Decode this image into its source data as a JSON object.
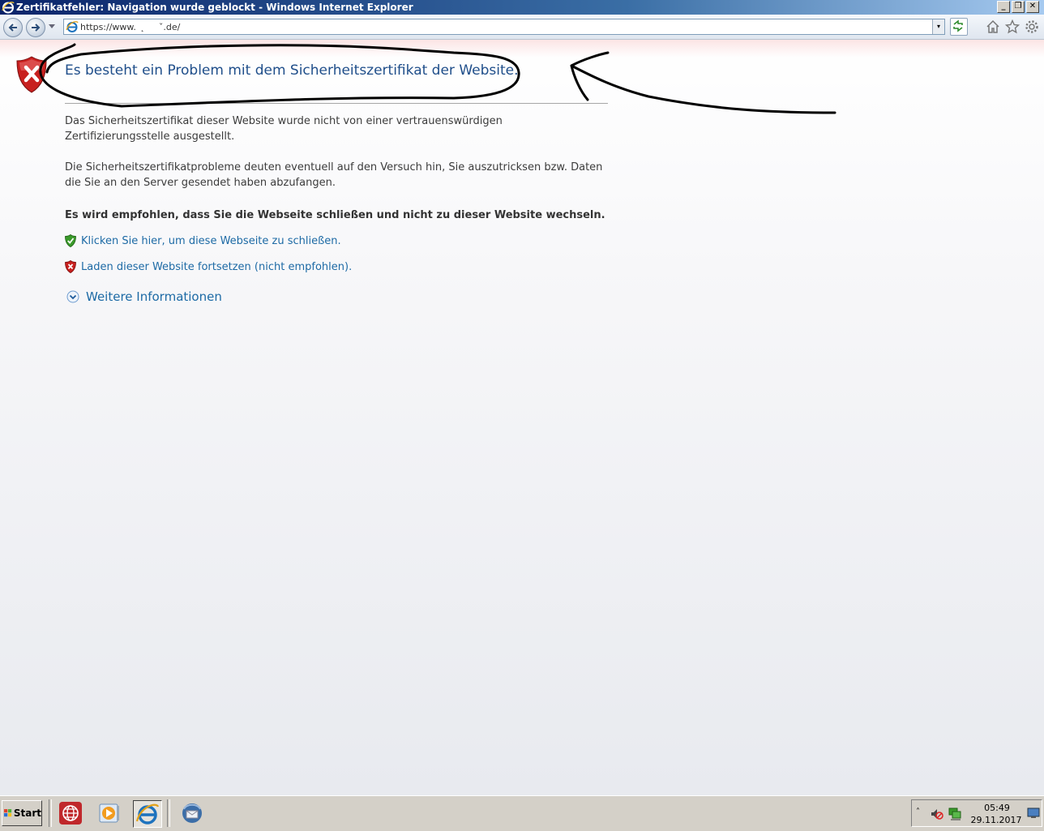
{
  "window": {
    "title": "Zertifikatfehler: Navigation wurde geblockt - Windows Internet Explorer",
    "controls": {
      "minimize": "_",
      "restore": "❐",
      "close": "✕"
    }
  },
  "nav": {
    "address_value": "https://www.   ̨     ˇ.de/",
    "dropdown_glyph": "▾"
  },
  "page": {
    "heading": "Es besteht ein Problem mit dem Sicherheitszertifikat der Website.",
    "para1": "Das Sicherheitszertifikat dieser Website wurde nicht von einer vertrauenswürdigen Zertifizierungsstelle ausgestellt.",
    "para2": "Die Sicherheitszertifikatprobleme deuten eventuell auf den Versuch hin, Sie auszutricksen bzw. Daten die Sie an den Server gesendet haben abzufangen.",
    "recommendation": "Es wird empfohlen, dass Sie die Webseite schließen und nicht zu dieser Website wechseln.",
    "link_close": "Klicken Sie hier, um diese Webseite zu schließen.",
    "link_continue": "Laden dieser Website fortsetzen (nicht empfohlen).",
    "more_info": "Weitere Informationen"
  },
  "taskbar": {
    "start_label": "Start",
    "tray_up": "˄",
    "clock_time": "05:49",
    "clock_date": "29.11.2017"
  },
  "colors": {
    "heading": "#1f4e8a",
    "link": "#1d6aa5",
    "error_red": "#c8201f",
    "ok_green": "#3a9a2a"
  }
}
